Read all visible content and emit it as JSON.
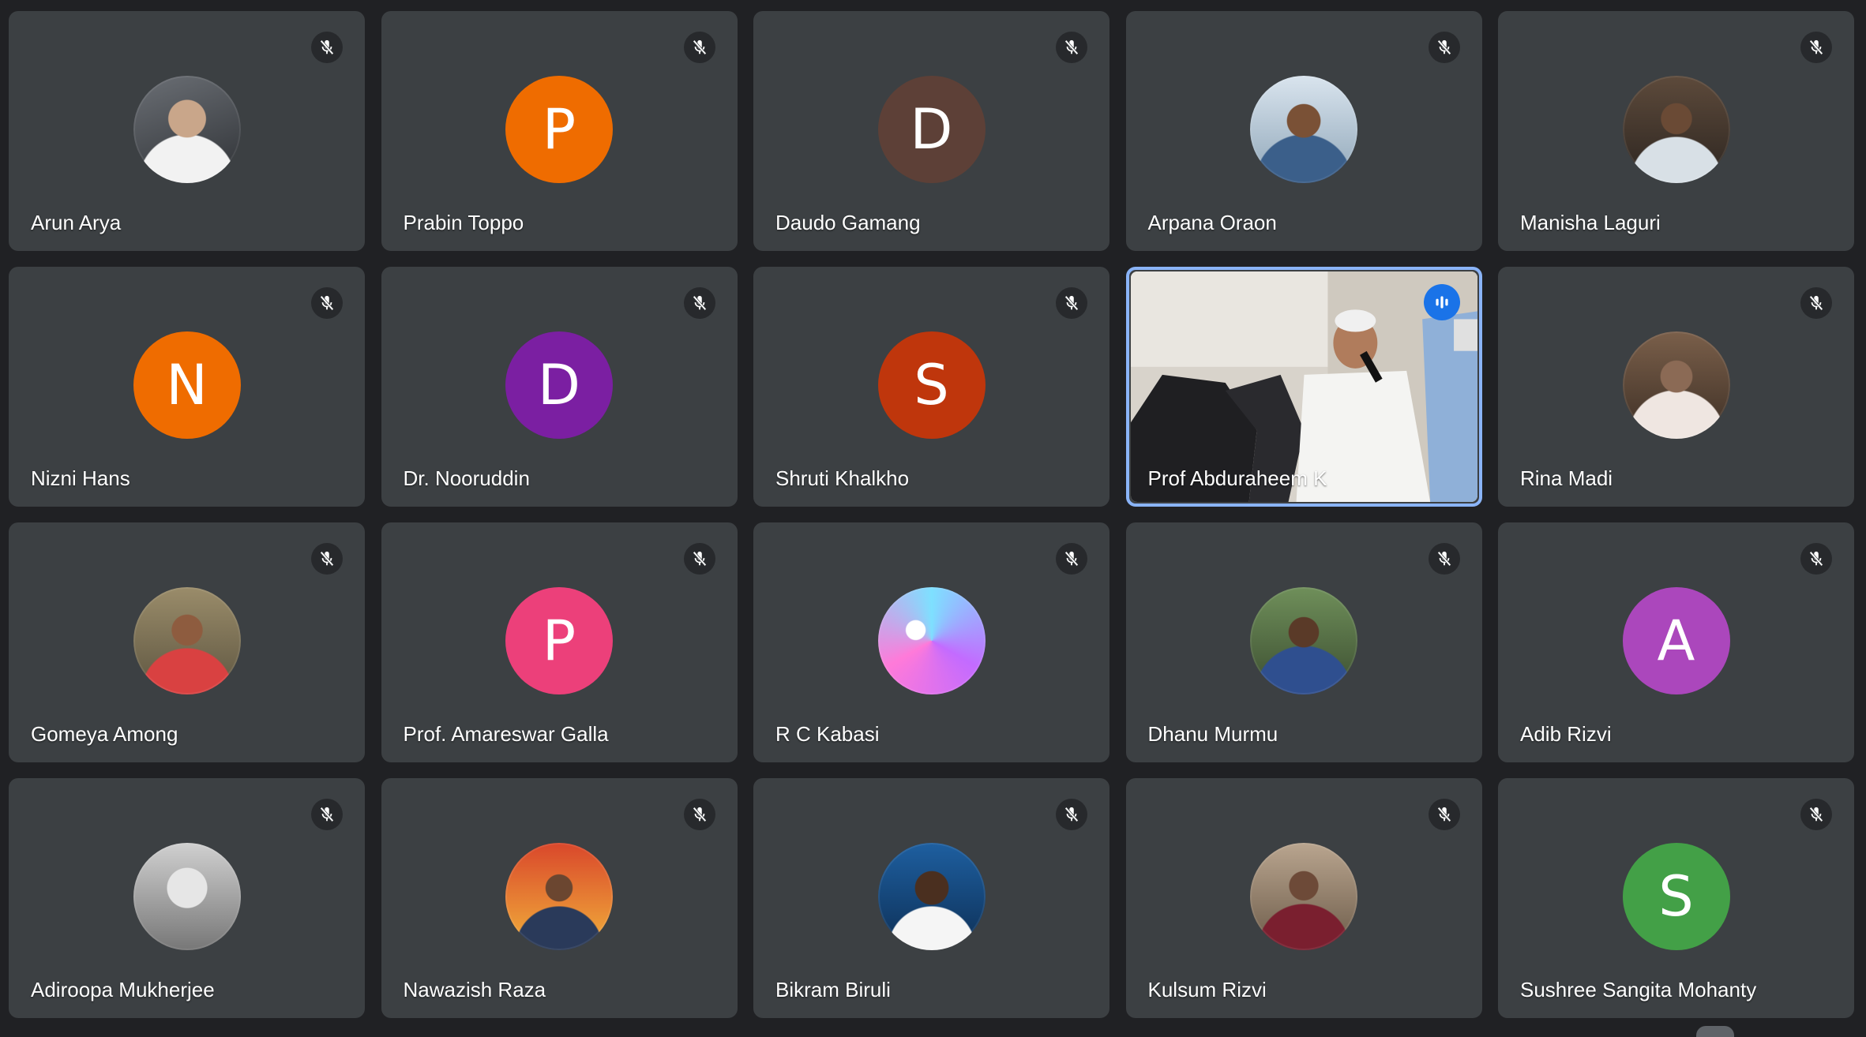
{
  "colors": {
    "background": "#202124",
    "tile": "#3c4043",
    "active_outline": "#8ab4f8",
    "speaking_badge": "#1a73e8"
  },
  "participants": [
    {
      "name": "Arun Arya",
      "avatar_type": "photo",
      "muted": true
    },
    {
      "name": "Prabin Toppo",
      "avatar_type": "initial",
      "initial": "P",
      "color": "#ef6c00",
      "muted": true
    },
    {
      "name": "Daudo Gamang",
      "avatar_type": "initial",
      "initial": "D",
      "color": "#5d4037",
      "muted": true
    },
    {
      "name": "Arpana Oraon",
      "avatar_type": "photo",
      "muted": true
    },
    {
      "name": "Manisha Laguri",
      "avatar_type": "photo",
      "muted": true
    },
    {
      "name": "Nizni Hans",
      "avatar_type": "initial",
      "initial": "N",
      "color": "#ef6c00",
      "muted": true
    },
    {
      "name": "Dr. Nooruddin",
      "avatar_type": "initial",
      "initial": "D",
      "color": "#7b1fa2",
      "muted": true
    },
    {
      "name": "Shruti Khalkho",
      "avatar_type": "initial",
      "initial": "S",
      "color": "#bf360c",
      "muted": true
    },
    {
      "name": "Prof Abduraheem K",
      "avatar_type": "video",
      "muted": false,
      "speaking": true
    },
    {
      "name": "Rina Madi",
      "avatar_type": "photo",
      "muted": true
    },
    {
      "name": "Gomeya Among",
      "avatar_type": "photo",
      "muted": true
    },
    {
      "name": "Prof. Amareswar Galla",
      "avatar_type": "initial",
      "initial": "P",
      "color": "#ec407a",
      "muted": true
    },
    {
      "name": "R C Kabasi",
      "avatar_type": "photo",
      "muted": true
    },
    {
      "name": "Dhanu Murmu",
      "avatar_type": "photo",
      "muted": true
    },
    {
      "name": "Adib Rizvi",
      "avatar_type": "initial",
      "initial": "A",
      "color": "#ab47bc",
      "muted": true
    },
    {
      "name": "Adiroopa Mukherjee",
      "avatar_type": "photo",
      "muted": true
    },
    {
      "name": "Nawazish Raza",
      "avatar_type": "photo",
      "muted": true
    },
    {
      "name": "Bikram Biruli",
      "avatar_type": "photo",
      "muted": true
    },
    {
      "name": "Kulsum Rizvi",
      "avatar_type": "photo",
      "muted": true
    },
    {
      "name": "Sushree Sangita Mohanty",
      "avatar_type": "initial",
      "initial": "S",
      "color": "#43a047",
      "muted": true
    }
  ]
}
